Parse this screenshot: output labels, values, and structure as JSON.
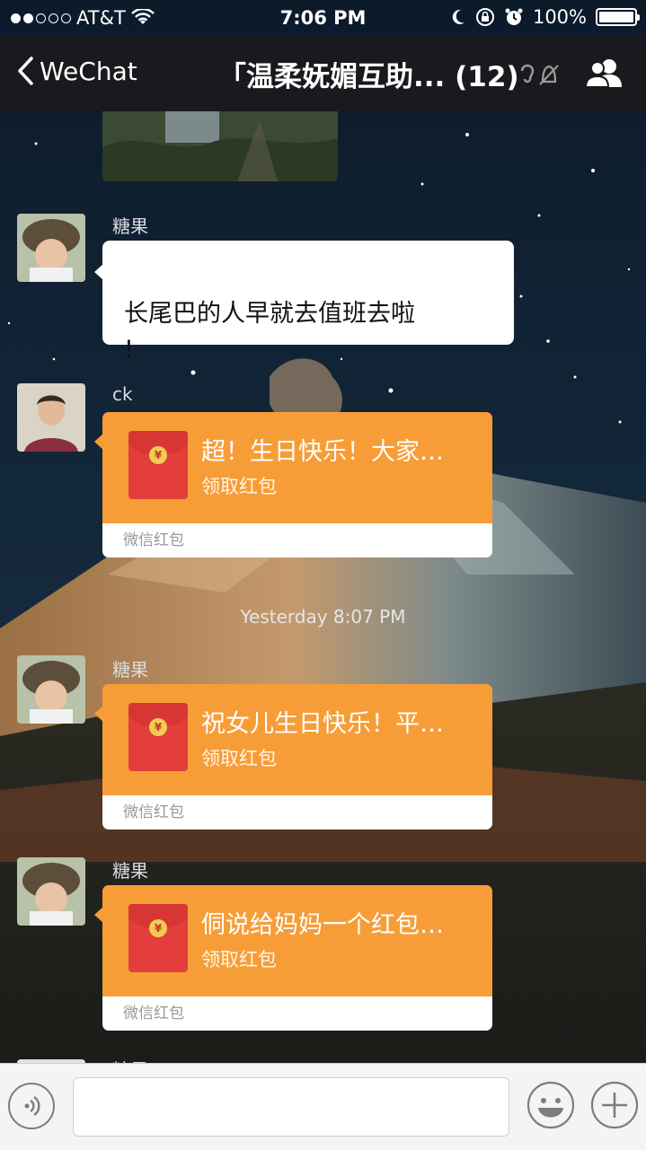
{
  "status_bar": {
    "carrier": "AT&T",
    "time": "7:06 PM",
    "battery": "100%",
    "signal_dots_filled": 2,
    "signal_dots_total": 5,
    "icons": [
      "wifi-icon",
      "moon-icon",
      "rotation-lock-icon",
      "alarm-icon",
      "battery-icon"
    ]
  },
  "navbar": {
    "back_label": "WeChat",
    "title": "「温柔妩媚互助...",
    "member_count": "(12)",
    "icons": [
      "back-chevron-icon",
      "muted-bell-icon",
      "group-members-icon"
    ]
  },
  "messages": [
    {
      "type": "image"
    },
    {
      "type": "text",
      "sender": "糖果",
      "text": "长尾巴的人早就去值班去啦\n!"
    },
    {
      "type": "red_packet",
      "sender": "ck",
      "title": "超！生日快乐！大家…",
      "sub": "领取红包",
      "footer": "微信红包"
    },
    {
      "type": "timestamp",
      "text": "Yesterday 8:07 PM"
    },
    {
      "type": "red_packet",
      "sender": "糖果",
      "title": "祝女儿生日快乐！平…",
      "sub": "领取红包",
      "footer": "微信红包"
    },
    {
      "type": "red_packet",
      "sender": "糖果",
      "title": "侗说给妈妈一个红包…",
      "sub": "领取红包",
      "footer": "微信红包"
    },
    {
      "type": "partial",
      "sender": "糖果"
    }
  ],
  "input_bar": {
    "icons": [
      "voice-icon",
      "emoji-icon",
      "plus-icon"
    ]
  },
  "colors": {
    "red_packet_orange": "#f79d38",
    "envelope_red": "#e33e3c",
    "navbar": "#1a1a1c"
  }
}
